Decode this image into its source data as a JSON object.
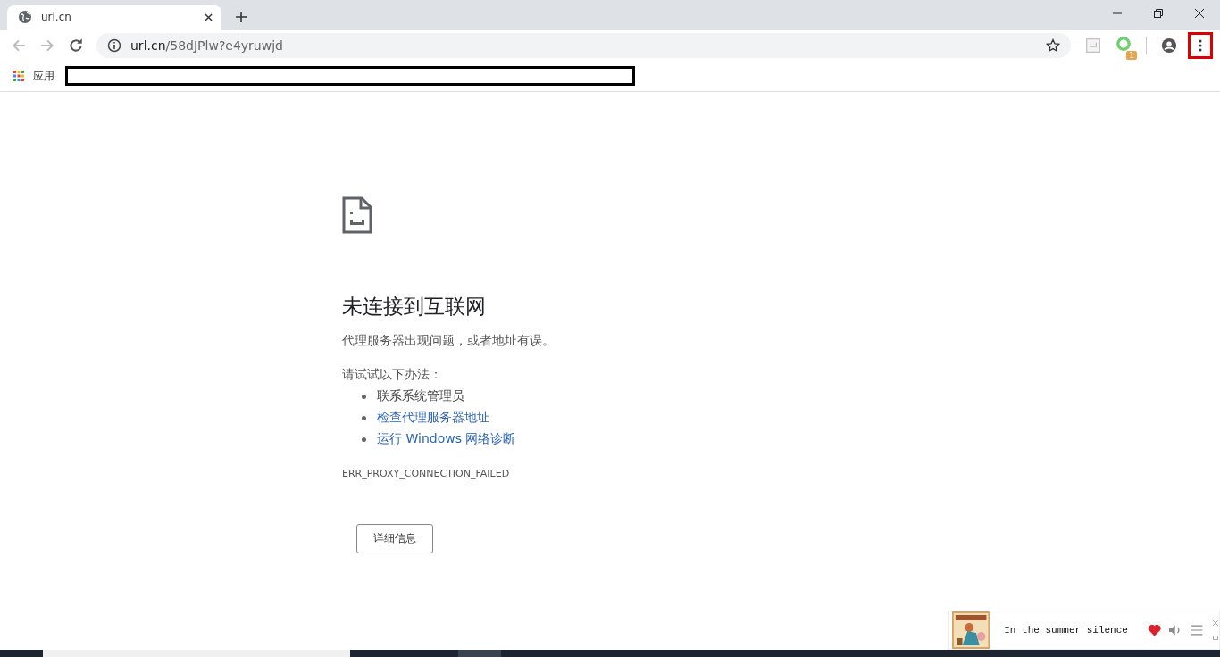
{
  "tab": {
    "title": "url.cn",
    "selected": true
  },
  "address": {
    "host": "url.cn",
    "path": "/58dJPlw?e4yruwjd"
  },
  "extension_badge": "1",
  "bookmarks_bar": {
    "apps_label": "应用"
  },
  "error_page": {
    "heading": "未连接到互联网",
    "description": "代理服务器出现问题，或者地址有误。",
    "suggestions_intro": "请试试以下办法：",
    "suggestions": [
      {
        "text": "联系系统管理员",
        "kind": "text"
      },
      {
        "text": "检查代理服务器地址",
        "kind": "link"
      },
      {
        "text": "运行 Windows 网络诊断",
        "kind": "link"
      }
    ],
    "error_code": "ERR_PROXY_CONNECTION_FAILED",
    "details_button": "详细信息"
  },
  "music_widget": {
    "song": "In the summer silence",
    "liked": true
  }
}
